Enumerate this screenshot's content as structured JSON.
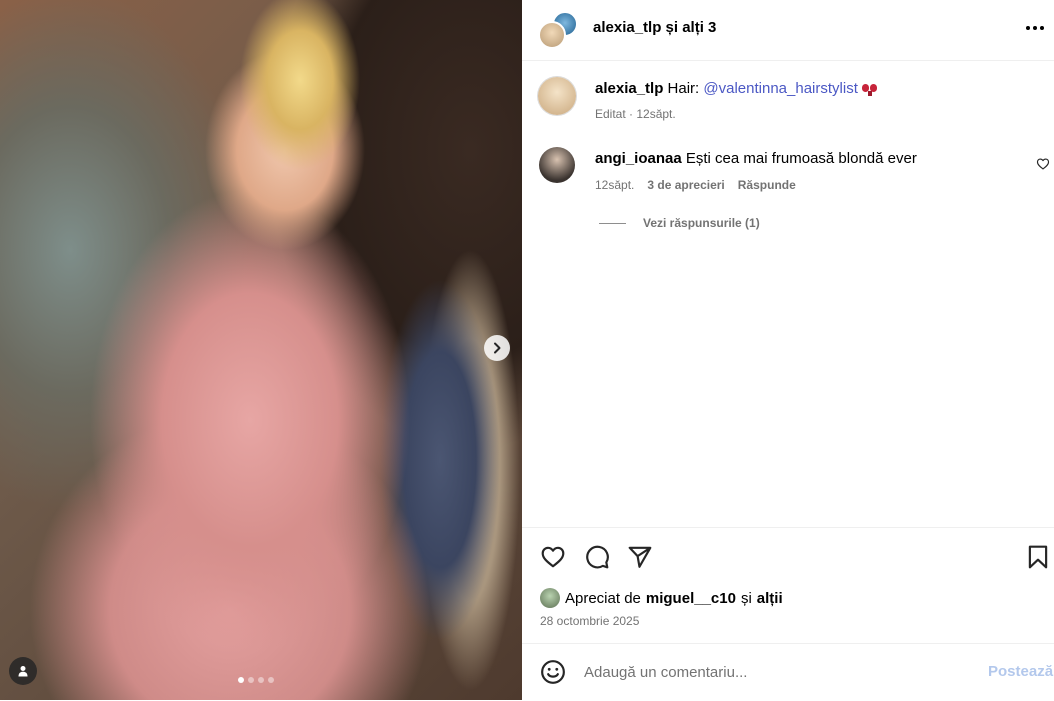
{
  "header": {
    "title": "alexia_tlp și alți 3",
    "more_icon": "more-horizontal-icon"
  },
  "caption": {
    "username": "alexia_tlp",
    "text": " Hair: ",
    "mention": "@valentinna_hairstylist",
    "emoji_icon": "ribbon-bow-icon",
    "meta": "Editat · 12săpt."
  },
  "comments": [
    {
      "username": "angi_ioanaa",
      "text": " Ești cea mai frumoasă blondă ever",
      "time": "12săpt.",
      "likes": "3 de aprecieri",
      "reply": "Răspunde",
      "view_replies": "Vezi răspunsurile (1)"
    }
  ],
  "carousel": {
    "current_slide": 1,
    "total_slides": 4
  },
  "likes": {
    "prefix": "Apreciat de",
    "user": "miguel__c10",
    "conj": "și",
    "others": "alții"
  },
  "date": "28 octombrie 2025",
  "comment_box": {
    "placeholder": "Adaugă un comentariu...",
    "post_label": "Postează"
  },
  "colors": {
    "mention": "#4b58c4",
    "post_disabled": "#b3c8ec",
    "muted": "#737373"
  }
}
